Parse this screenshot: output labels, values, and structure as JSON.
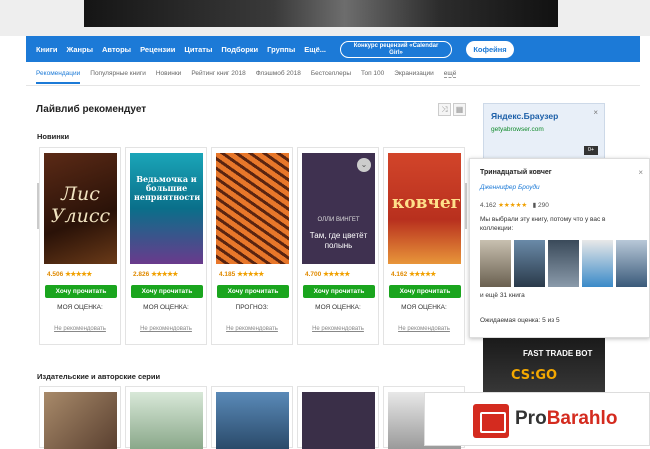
{
  "nav": {
    "items": [
      "Книги",
      "Жанры",
      "Авторы",
      "Рецензии",
      "Цитаты",
      "Подборки",
      "Группы",
      "Ещё..."
    ],
    "contest_line1": "Конкурс рецензий «Calendar",
    "contest_line2": "Girl»",
    "coffee": "Кофейня"
  },
  "subnav": {
    "items": [
      "Рекомендации",
      "Популярные книги",
      "Новинки",
      "Рейтинг книг 2018",
      "Флэшмоб 2018",
      "Бестселлеры",
      "Топ 100",
      "Экранизации",
      "ещё"
    ]
  },
  "main": {
    "title": "Лайвлиб рекомендует",
    "section1": "Новинки",
    "section2": "Издательские и авторские серии"
  },
  "books": [
    {
      "cover_title": "Лис Улисс",
      "rating": "4.506",
      "stars": "★★★★★",
      "want": "Хочу прочитать",
      "label": "МОЯ ОЦЕНКА:",
      "notrec": "Не рекомендовать"
    },
    {
      "cover_title": "Ведьмочка и большие неприятности",
      "rating": "2.826",
      "stars": "★★★★★",
      "want": "Хочу прочитать",
      "label": "МОЯ ОЦЕНКА:",
      "notrec": "Не рекомендовать"
    },
    {
      "cover_title": "",
      "rating": "4.185",
      "stars": "★★★★★",
      "want": "Хочу прочитать",
      "label": "ПРОГНОЗ:",
      "notrec": "Не рекомендовать"
    },
    {
      "cover_author": "ОЛЛИ ВИНГЕТ",
      "cover_title": "Там, где цветёт полынь",
      "rating": "4.700",
      "stars": "★★★★★",
      "want": "Хочу прочитать",
      "label": "МОЯ ОЦЕНКА:",
      "notrec": "Не рекомендовать"
    },
    {
      "cover_title": "ковчег",
      "rating": "4.162",
      "stars": "★★★★★",
      "want": "Хочу прочитать",
      "label": "МОЯ ОЦЕНКА:",
      "notrec": "Не рекомендовать"
    }
  ],
  "ad": {
    "brand": "Яндекс.Браузер",
    "url": "getyabrowser.com",
    "close": "×",
    "badge": "0+"
  },
  "popup": {
    "title": "Тринадцатый ковчег",
    "author": "Дженнифер Броуди",
    "rating": "4.162",
    "stars": "★★★★★",
    "count": "290",
    "reason": "Мы выбрали эту книгу, потому что у вас в коллекции:",
    "more": "и ещё 31 книга",
    "expected": "Ожидаемая оценка: 5 из 5",
    "close": "×"
  },
  "ad2": {
    "line1": "FAST TRADE BOT",
    "line2": "CS:GO"
  },
  "watermark": {
    "pro": "Pro",
    "barahlo": "Barahlo"
  },
  "colors": {
    "nav_blue": "#1c7ad7",
    "want_green": "#1aa51e",
    "star": "#f0a000"
  }
}
